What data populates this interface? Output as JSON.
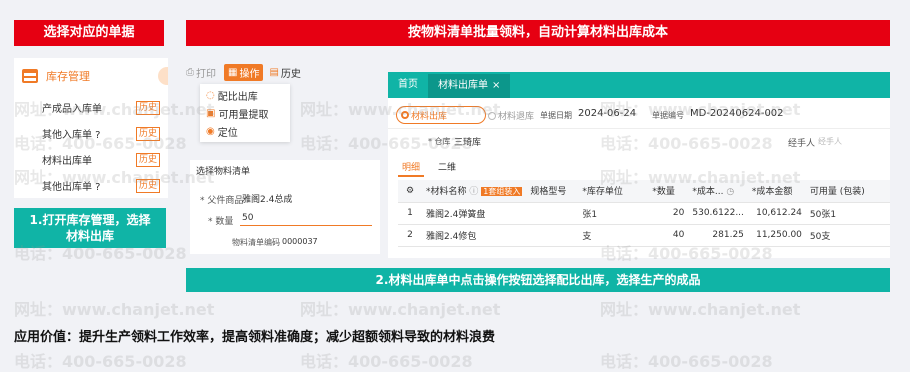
{
  "left": {
    "banner": "选择对应的单据",
    "menu_title": "库存管理",
    "items": [
      {
        "label": "产成品入库单",
        "history": "历史"
      },
      {
        "label": "其他入库单 ?",
        "history": "历史"
      },
      {
        "label": "材料出库单",
        "history": "历史"
      },
      {
        "label": "其他出库单 ?",
        "history": "历史"
      }
    ],
    "caption": "1.打开库存管理，选择材料出库"
  },
  "top_banner": "按物料清单批量领料，自动计算材料出库成本",
  "ops": {
    "print": "打印",
    "operate": "操作",
    "history": "历史",
    "menu": [
      "配比出库",
      "可用量提取",
      "定位"
    ]
  },
  "bom": {
    "title": "选择物料清单",
    "parent_label": "* 父件商品",
    "parent_value": "雅阁2.4总成",
    "qty_label": "* 数量",
    "qty_value": "50",
    "code_label": "物料清单编码",
    "code_value": "0000037"
  },
  "form": {
    "tab_home": "首页",
    "tab_active": "材料出库单",
    "tab_close": "×",
    "radio1": "材料出库",
    "radio2": "材料退库",
    "date_label": "单据日期",
    "date_value": "2024-06-24",
    "no_label": "单据编号",
    "no_value": "MD-20240624-002",
    "warehouse_label": "* 仓库",
    "warehouse_value": "三琦库",
    "handler_label": "经手人",
    "handler_placeholder": "经手人",
    "subtab1": "明细",
    "subtab2": "二维",
    "columns": [
      "",
      "*材料名称",
      "规格型号",
      "*库存单位",
      "*数量",
      "*成本...",
      "*成本金额",
      "可用量 (包装)"
    ],
    "badge": "1套组装入",
    "rows": [
      {
        "idx": "1",
        "name": "雅阁2.4弹簧盘",
        "spec": "",
        "unit": "张1",
        "qty": "20",
        "cost": "530.6122...",
        "amount": "10,612.24",
        "avail": "50张1"
      },
      {
        "idx": "2",
        "name": "雅阁2.4修包",
        "spec": "",
        "unit": "支",
        "qty": "40",
        "cost": "281.25",
        "amount": "11,250.00",
        "avail": "50支"
      }
    ]
  },
  "bottom_caption": "2.材料出库单中点击操作按钮选择配比出库，选择生产的成品",
  "value_statement": "应用价值：提升生产领料工作效率，提高领料准确度；减少超额领料导致的材料浪费",
  "watermarks": {
    "url": "网址：www.chanjet.net",
    "tel": "电话：400-665-0028"
  },
  "colors": {
    "red": "#e60012",
    "teal": "#10b4a6",
    "orange": "#f07a26"
  }
}
